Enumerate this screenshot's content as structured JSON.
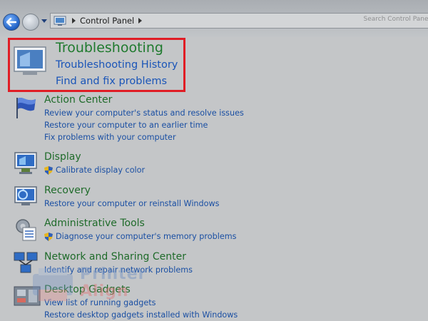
{
  "address_bar": {
    "crumb": "Control Panel",
    "search_hint": "Search Control Panel"
  },
  "highlighted": {
    "title": "Troubleshooting",
    "links": [
      "Troubleshooting History",
      "Find and fix problems"
    ],
    "highlight_color": "#e01d25"
  },
  "items": [
    {
      "title": "Action Center",
      "icon": "flag-icon",
      "links": [
        "Review your computer's status and resolve issues",
        "Restore your computer to an earlier time",
        "Fix problems with your computer"
      ]
    },
    {
      "title": "Display",
      "icon": "monitor-icon",
      "links": [
        "Calibrate display color"
      ]
    },
    {
      "title": "Recovery",
      "icon": "recovery-icon",
      "links": [
        "Restore your computer or reinstall Windows"
      ]
    },
    {
      "title": "Administrative Tools",
      "icon": "admin-tools-icon",
      "links": [
        "Diagnose your computer's memory problems"
      ]
    },
    {
      "title": "Network and Sharing Center",
      "icon": "network-icon",
      "links": [
        "Identify and repair network problems"
      ]
    },
    {
      "title": "Desktop Gadgets",
      "icon": "gadgets-icon",
      "links": [
        "View list of running gadgets",
        "Restore desktop gadgets installed with Windows"
      ]
    }
  ],
  "watermark": {
    "line1": "Printer",
    "line2": "Align"
  },
  "colors": {
    "title_green": "#1f6b2a",
    "link_blue": "#1a4fa3",
    "background": "#c4c6c8"
  }
}
